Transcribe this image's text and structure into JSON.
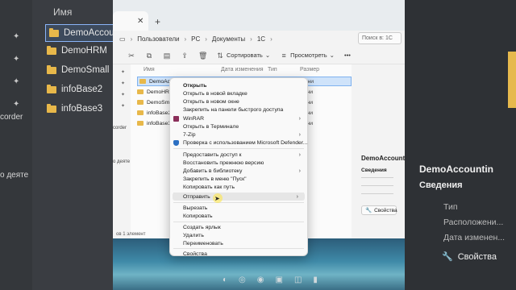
{
  "background": {
    "left": {
      "header": "Имя",
      "folders": [
        "DemoAccountin",
        "DemoHRM",
        "DemoSmall",
        "infoBase2",
        "infoBase3"
      ],
      "side_text_1": "corder",
      "side_text_2": "о деяте"
    },
    "right": {
      "title": "DemoAccountin",
      "section": "Сведения",
      "props": [
        "Тип",
        "Расположени...",
        "Дата изменен..."
      ],
      "button_label": "Свойства"
    }
  },
  "window": {
    "breadcrumb": [
      "Пользователи",
      "PC",
      "Документы",
      "1C"
    ],
    "search_placeholder": "Поиск в: 1C",
    "toolbar": {
      "sort_label": "Сортировать",
      "view_label": "Просмотреть",
      "more_label": "•••"
    },
    "columns": [
      "Имя",
      "Дата изменения",
      "Тип",
      "Размер"
    ],
    "files": [
      {
        "name": "DemoAccounting",
        "extra": "мени"
      },
      {
        "name": "DemoHRM",
        "extra": "мени"
      },
      {
        "name": "DemoSmall",
        "extra": "мени"
      },
      {
        "name": "infoBase2",
        "extra": "мени"
      },
      {
        "name": "infoBase3",
        "extra": "мени"
      }
    ],
    "nav_left_text_1": "corder",
    "nav_left_text_2": "о деяте",
    "status": "ов 1 элемент",
    "details": {
      "title": "DemoAccountin",
      "section": "Сведения",
      "button_label": "Свойства"
    }
  },
  "context_menu": {
    "items": [
      {
        "label": "Открыть",
        "bold": true
      },
      {
        "label": "Открыть в новой вкладке"
      },
      {
        "label": "Открыть в новом окне"
      },
      {
        "label": "Закрепить на панели быстрого доступа"
      },
      {
        "label": "WinRAR",
        "submenu": true,
        "icon": "winrar-icon"
      },
      {
        "label": "Открыть в Терминале"
      },
      {
        "label": "7-Zip",
        "submenu": true
      },
      {
        "label": "Проверка с использованием Microsoft Defender...",
        "icon": "defender-icon"
      },
      {
        "label": "Предоставить доступ к",
        "submenu": true
      },
      {
        "label": "Восстановить прежнюю версию"
      },
      {
        "label": "Добавить в библиотеку",
        "submenu": true
      },
      {
        "label": "Закрепить в меню \"Пуск\""
      },
      {
        "label": "Копировать как путь"
      },
      {
        "label": "Отправить",
        "submenu": true,
        "highlighted": true
      },
      {
        "label": "Вырезать"
      },
      {
        "label": "Копировать"
      },
      {
        "label": "Создать ярлык"
      },
      {
        "label": "Удалить"
      },
      {
        "label": "Переименовать"
      },
      {
        "label": "Свойства"
      }
    ]
  },
  "colors": {
    "folder": "#e8b84a",
    "selection": "#cfe3fa",
    "selection_border": "#7fb2ef"
  }
}
